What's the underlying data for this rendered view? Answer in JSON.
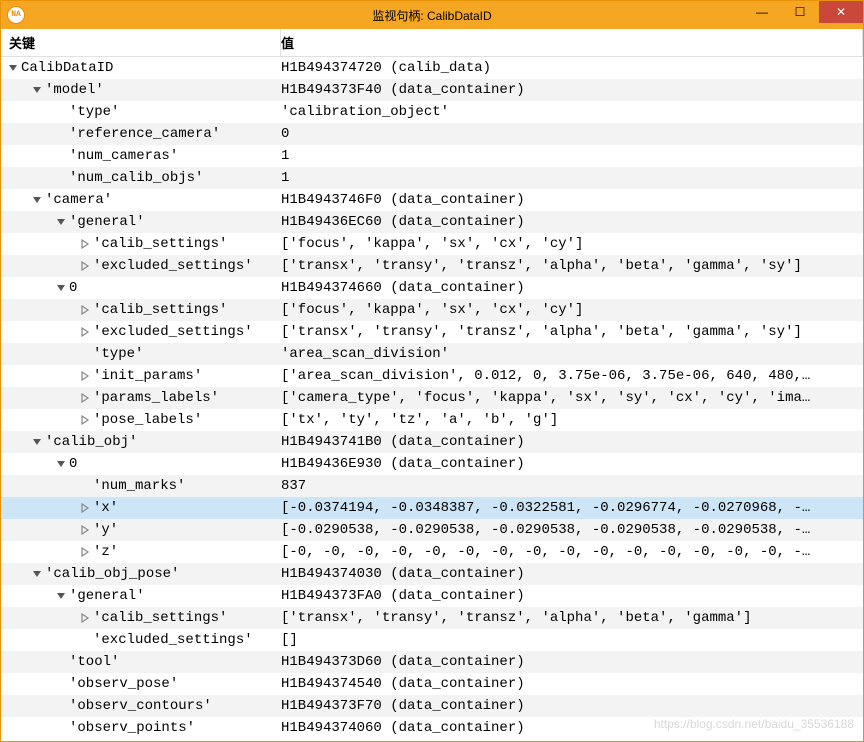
{
  "window": {
    "title": "监视句柄: CalibDataID",
    "icon_label": "NA"
  },
  "headers": {
    "key": "关键",
    "value": "值"
  },
  "win_buttons": {
    "min": "—",
    "max": "☐",
    "close": "✕"
  },
  "watermark": "https://blog.csdn.net/baidu_35536188",
  "rows": [
    {
      "depth": 0,
      "toggle": "open",
      "alt": false,
      "sel": false,
      "key": "CalibDataID",
      "val": "H1B494374720 (calib_data)"
    },
    {
      "depth": 1,
      "toggle": "open",
      "alt": true,
      "sel": false,
      "key": "'model'",
      "val": "H1B494373F40 (data_container)"
    },
    {
      "depth": 2,
      "toggle": "none",
      "alt": false,
      "sel": false,
      "key": "'type'",
      "val": "'calibration_object'"
    },
    {
      "depth": 2,
      "toggle": "none",
      "alt": true,
      "sel": false,
      "key": "'reference_camera'",
      "val": "0"
    },
    {
      "depth": 2,
      "toggle": "none",
      "alt": false,
      "sel": false,
      "key": "'num_cameras'",
      "val": "1"
    },
    {
      "depth": 2,
      "toggle": "none",
      "alt": true,
      "sel": false,
      "key": "'num_calib_objs'",
      "val": "1"
    },
    {
      "depth": 1,
      "toggle": "open",
      "alt": false,
      "sel": false,
      "key": "'camera'",
      "val": "H1B4943746F0 (data_container)"
    },
    {
      "depth": 2,
      "toggle": "open",
      "alt": true,
      "sel": false,
      "key": "'general'",
      "val": "H1B49436EC60 (data_container)"
    },
    {
      "depth": 3,
      "toggle": "closed",
      "alt": false,
      "sel": false,
      "key": "'calib_settings'",
      "val": "['focus', 'kappa', 'sx', 'cx', 'cy']"
    },
    {
      "depth": 3,
      "toggle": "closed",
      "alt": true,
      "sel": false,
      "key": "'excluded_settings'",
      "val": "['transx', 'transy', 'transz', 'alpha', 'beta', 'gamma', 'sy']"
    },
    {
      "depth": 2,
      "toggle": "open",
      "alt": false,
      "sel": false,
      "key": "0",
      "val": "H1B494374660 (data_container)"
    },
    {
      "depth": 3,
      "toggle": "closed",
      "alt": true,
      "sel": false,
      "key": "'calib_settings'",
      "val": "['focus', 'kappa', 'sx', 'cx', 'cy']"
    },
    {
      "depth": 3,
      "toggle": "closed",
      "alt": false,
      "sel": false,
      "key": "'excluded_settings'",
      "val": "['transx', 'transy', 'transz', 'alpha', 'beta', 'gamma', 'sy']"
    },
    {
      "depth": 3,
      "toggle": "none",
      "alt": true,
      "sel": false,
      "key": "'type'",
      "val": "'area_scan_division'"
    },
    {
      "depth": 3,
      "toggle": "closed",
      "alt": false,
      "sel": false,
      "key": "'init_params'",
      "val": "['area_scan_division', 0.012, 0, 3.75e-06, 3.75e-06, 640, 480,…"
    },
    {
      "depth": 3,
      "toggle": "closed",
      "alt": true,
      "sel": false,
      "key": "'params_labels'",
      "val": "['camera_type', 'focus', 'kappa', 'sx', 'sy', 'cx', 'cy', 'ima…"
    },
    {
      "depth": 3,
      "toggle": "closed",
      "alt": false,
      "sel": false,
      "key": "'pose_labels'",
      "val": "['tx', 'ty', 'tz', 'a', 'b', 'g']"
    },
    {
      "depth": 1,
      "toggle": "open",
      "alt": true,
      "sel": false,
      "key": "'calib_obj'",
      "val": "H1B4943741B0 (data_container)"
    },
    {
      "depth": 2,
      "toggle": "open",
      "alt": false,
      "sel": false,
      "key": "0",
      "val": "H1B49436E930 (data_container)"
    },
    {
      "depth": 3,
      "toggle": "none",
      "alt": true,
      "sel": false,
      "key": "'num_marks'",
      "val": "837"
    },
    {
      "depth": 3,
      "toggle": "closed",
      "alt": false,
      "sel": true,
      "key": "'x'",
      "val": "[-0.0374194, -0.0348387, -0.0322581, -0.0296774, -0.0270968, -…"
    },
    {
      "depth": 3,
      "toggle": "closed",
      "alt": true,
      "sel": false,
      "key": "'y'",
      "val": "[-0.0290538, -0.0290538, -0.0290538, -0.0290538, -0.0290538, -…"
    },
    {
      "depth": 3,
      "toggle": "closed",
      "alt": false,
      "sel": false,
      "key": "'z'",
      "val": "[-0, -0, -0, -0, -0, -0, -0, -0, -0, -0, -0, -0, -0, -0, -0, -…"
    },
    {
      "depth": 1,
      "toggle": "open",
      "alt": true,
      "sel": false,
      "key": "'calib_obj_pose'",
      "val": "H1B494374030 (data_container)"
    },
    {
      "depth": 2,
      "toggle": "open",
      "alt": false,
      "sel": false,
      "key": "'general'",
      "val": "H1B494373FA0 (data_container)"
    },
    {
      "depth": 3,
      "toggle": "closed",
      "alt": true,
      "sel": false,
      "key": "'calib_settings'",
      "val": "['transx', 'transy', 'transz', 'alpha', 'beta', 'gamma']"
    },
    {
      "depth": 3,
      "toggle": "none",
      "alt": false,
      "sel": false,
      "key": "'excluded_settings'",
      "val": "[]"
    },
    {
      "depth": 2,
      "toggle": "none",
      "alt": true,
      "sel": false,
      "key": "'tool'",
      "val": "H1B494373D60 (data_container)"
    },
    {
      "depth": 2,
      "toggle": "none",
      "alt": false,
      "sel": false,
      "key": "'observ_pose'",
      "val": "H1B494374540 (data_container)"
    },
    {
      "depth": 2,
      "toggle": "none",
      "alt": true,
      "sel": false,
      "key": "'observ_contours'",
      "val": "H1B494373F70 (data_container)"
    },
    {
      "depth": 2,
      "toggle": "none",
      "alt": false,
      "sel": false,
      "key": "'observ_points'",
      "val": "H1B494374060 (data_container)"
    }
  ]
}
